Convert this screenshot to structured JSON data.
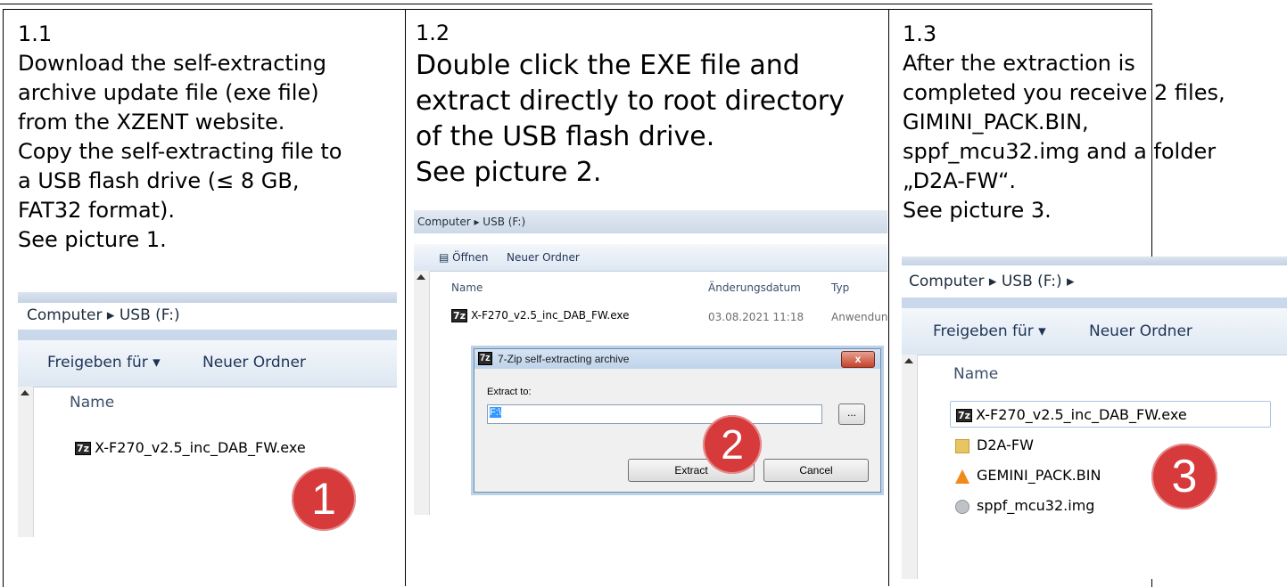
{
  "steps": [
    {
      "number": "1.1",
      "lines": [
        "Download the self-extracting",
        "archive update file (exe file)",
        "from the XZENT website.",
        "Copy the self-extracting file to",
        "a USB flash drive (≤ 8 GB,",
        "FAT32 format).",
        "See picture 1."
      ],
      "screenshot": {
        "breadcrumb": "Computer ▸ USB (F:)",
        "toolbar": [
          "Freigeben für ▾",
          "Neuer Ordner"
        ],
        "column_name": "Name",
        "file": "X-F270_v2.5_inc_DAB_FW.exe",
        "badge": "1"
      }
    },
    {
      "number": "1.2",
      "lines": [
        "Double click the EXE file and",
        "extract directly to root directory",
        "of the USB flash drive.",
        "See picture 2."
      ],
      "screenshot": {
        "breadcrumb": "Computer ▸ USB (F:)",
        "toolbar": [
          "Öffnen",
          "Neuer Ordner"
        ],
        "columns": [
          "Name",
          "Änderungsdatum",
          "Typ"
        ],
        "file": "X-F270_v2.5_inc_DAB_FW.exe",
        "date": "03.08.2021 11:18",
        "type": "Anwendung",
        "dialog": {
          "title": "7-Zip self-extracting archive",
          "label": "Extract to:",
          "value": "F:\\",
          "browse": "...",
          "extract": "Extract",
          "cancel": "Cancel",
          "close": "x"
        },
        "badge": "2"
      }
    },
    {
      "number": "1.3",
      "lines": [
        "After the extraction is",
        "completed you receive 2 files,",
        "GIMINI_PACK.BIN,",
        "sppf_mcu32.img and a folder",
        "„D2A-FW“.",
        "See picture 3."
      ],
      "screenshot": {
        "breadcrumb": "Computer ▸ USB (F:) ▸",
        "toolbar": [
          "Freigeben für ▾",
          "Neuer Ordner"
        ],
        "column_name": "Name",
        "files": [
          "X-F270_v2.5_inc_DAB_FW.exe",
          "D2A-FW",
          "GEMINI_PACK.BIN",
          "sppf_mcu32.img"
        ],
        "badge": "3"
      }
    }
  ],
  "icons": {
    "archive": "7z",
    "folder": "folder-icon",
    "vlc": "cone-icon",
    "disk": "disk-image-icon"
  }
}
